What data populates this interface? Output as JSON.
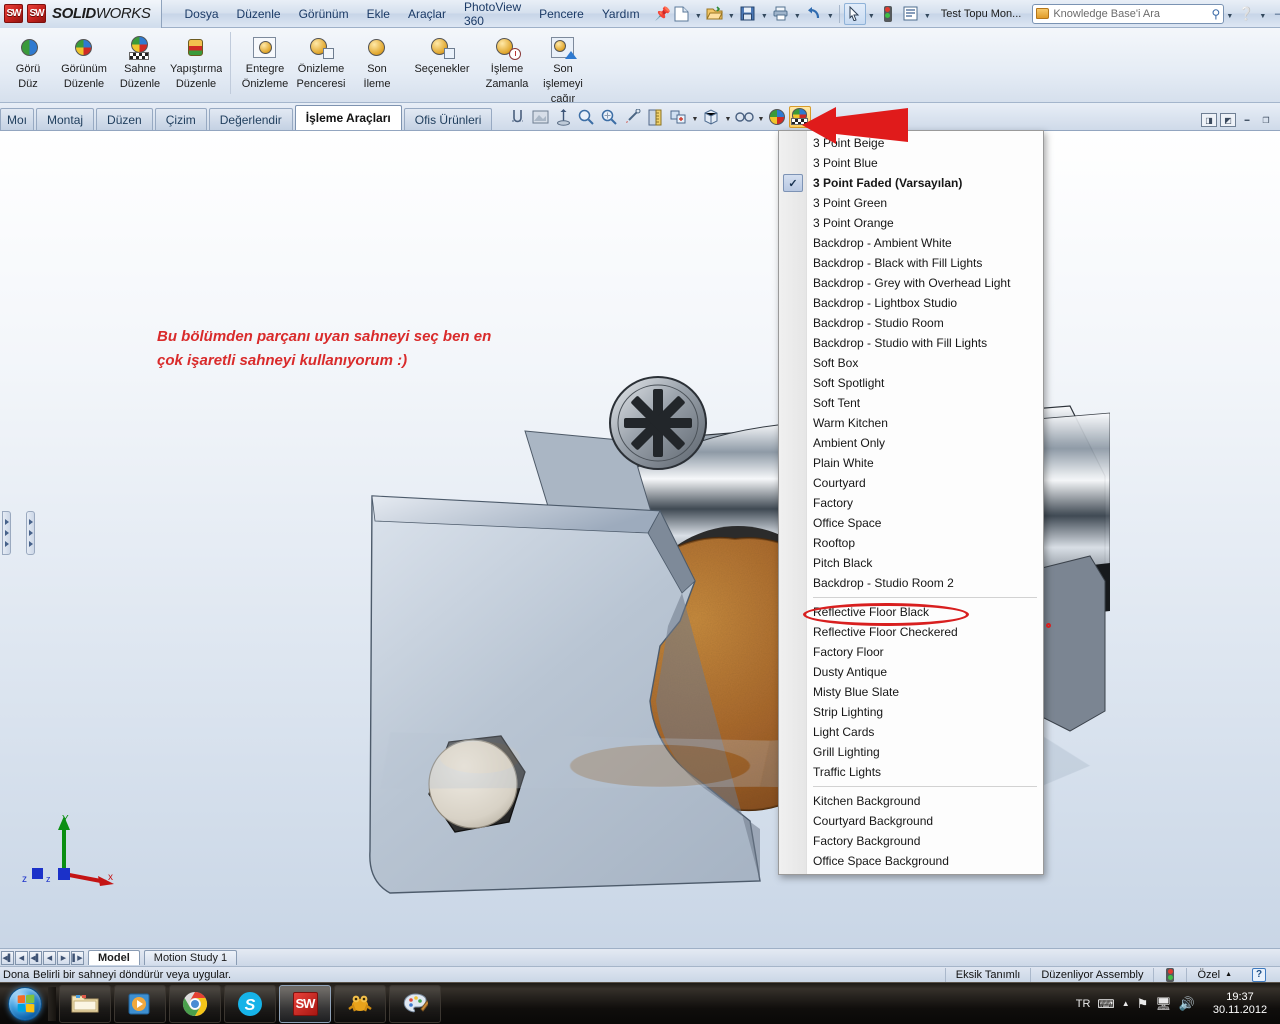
{
  "titlebar": {
    "brand": "SOLIDWORKS",
    "brand_bold": "SOLID",
    "brand_light": "WORKS",
    "menus": [
      "Dosya",
      "Düzenle",
      "Görünüm",
      "Ekle",
      "Araçlar",
      "PhotoView 360",
      "Pencere",
      "Yardım"
    ],
    "document_name": "Test Topu Mon...",
    "search_placeholder": "Knowledge Base'i Ara",
    "quick_icons": [
      "new-document-icon",
      "open-folder-icon",
      "save-icon",
      "print-icon",
      "undo-icon",
      "select-arrow-icon",
      "traffic-light-icon",
      "options-list-icon"
    ],
    "help_label": "?",
    "window_buttons": [
      "minimize",
      "restore"
    ]
  },
  "ribbon": {
    "buttons": [
      {
        "label": "Görü\nDüz",
        "line1": "Görü",
        "line2": "Düz",
        "icon": "appearance-half-ball-icon"
      },
      {
        "label": "Görünüm Düzenle",
        "line1": "Görünüm",
        "line2": "Düzenle",
        "icon": "appearance-ball-icon"
      },
      {
        "label": "Sahne Düzenle",
        "line1": "Sahne",
        "line2": "Düzenle",
        "icon": "scene-checker-ball-icon"
      },
      {
        "label": "Yapıştırma Düzenle",
        "line1": "Yapıştırma",
        "line2": "Düzenle",
        "icon": "decal-jar-icon"
      },
      {
        "label": "Entegre Önizleme",
        "line1": "Entegre",
        "line2": "Önizleme",
        "icon": "integrated-preview-icon"
      },
      {
        "label": "Önizleme Penceresi",
        "line1": "Önizleme",
        "line2": "Penceresi",
        "icon": "preview-window-icon"
      },
      {
        "label": "Son İleme",
        "line1": "Son",
        "line2": "İleme",
        "icon": "final-render-icon"
      },
      {
        "label": "Seçenekler",
        "line1": "Seçenekler",
        "line2": "",
        "icon": "options-icon"
      },
      {
        "label": "İşleme Zamanla",
        "line1": "İşleme",
        "line2": "Zamanla",
        "icon": "schedule-render-icon"
      },
      {
        "label": "Son işlemeyi çağır",
        "line1": "Son",
        "line2": "işlemeyi",
        "line3": "çağır",
        "icon": "recall-render-icon"
      }
    ]
  },
  "tabs": {
    "items": [
      "Moı",
      "Montaj",
      "Düzen",
      "Çizim",
      "Değerlendir",
      "İşleme Araçları",
      "Ofis Ürünleri"
    ],
    "active": "İşleme Araçları",
    "toolbar_icons": [
      "mate-icon",
      "hidden-edge-icon",
      "move-component-icon",
      "zoom-area-icon",
      "zoom-fit-icon",
      "section-view-icon",
      "measure-icon",
      "view-orientation-icon",
      "display-style-icon",
      "hide-show-icon",
      "appearance-ball-icon",
      "scene-checker-ball-icon"
    ],
    "window_controls": [
      "restore-left",
      "restore-right",
      "minimize",
      "restore"
    ]
  },
  "viewport": {
    "annotation": {
      "line1": "Bu bölümden parçanı uyan sahneyi seç ben en",
      "line2": "çok işaretli sahneyi kullanıyorum :)",
      "color": "#d92b2b"
    },
    "triad": {
      "x": "x",
      "y": "Y",
      "z": "z"
    },
    "red_arrow": "red-arrow-pointing-left"
  },
  "scene_menu": {
    "checked_item": "3 Point Faded  (Varsayılan)",
    "highlighted_item": "Reflective Floor Black",
    "groups": [
      {
        "items": [
          "3 Point Beige",
          "3 Point Blue",
          "3 Point Faded  (Varsayılan)",
          "3 Point Green",
          "3 Point Orange",
          "Backdrop - Ambient White",
          "Backdrop - Black with Fill Lights",
          "Backdrop - Grey with Overhead Light",
          "Backdrop - Lightbox Studio",
          "Backdrop - Studio Room",
          "Backdrop - Studio with Fill Lights",
          "Soft Box",
          "Soft Spotlight",
          "Soft Tent",
          "Warm Kitchen",
          "Ambient Only",
          "Plain White",
          "Courtyard",
          "Factory",
          "Office Space",
          "Rooftop",
          "Pitch Black",
          "Backdrop - Studio Room 2"
        ]
      },
      {
        "items": [
          "Reflective Floor Black",
          "Reflective Floor Checkered",
          "Factory Floor",
          "Dusty Antique",
          "Misty Blue Slate",
          "Strip Lighting",
          "Light Cards",
          "Grill Lighting",
          "Traffic Lights"
        ]
      },
      {
        "items": [
          "Kitchen Background",
          "Courtyard Background",
          "Factory Background",
          "Office Space Background"
        ]
      }
    ]
  },
  "bottom_tabs": {
    "items": [
      "Model",
      "Motion Study 1"
    ],
    "active": "Model"
  },
  "statusbar": {
    "left_truncated": "Dona",
    "message": "Belirli bir sahneyi döndürür veya uygular.",
    "cells": [
      "Eksik Tanımlı",
      "Düzenliyor Assembly"
    ],
    "custom_label": "Özel",
    "help_badge": "?"
  },
  "taskbar": {
    "apps": [
      {
        "name": "windows-explorer-icon",
        "label": "Windows Explorer"
      },
      {
        "name": "media-player-icon",
        "label": "Windows Media Player"
      },
      {
        "name": "chrome-icon",
        "label": "Google Chrome"
      },
      {
        "name": "skype-icon",
        "label": "Skype"
      },
      {
        "name": "solidworks-icon",
        "label": "SolidWorks"
      },
      {
        "name": "frog-icon",
        "label": "Camtasia"
      },
      {
        "name": "paint-icon",
        "label": "Paint"
      }
    ],
    "tray": {
      "language": "TR",
      "time": "19:37",
      "date": "30.11.2012"
    }
  }
}
